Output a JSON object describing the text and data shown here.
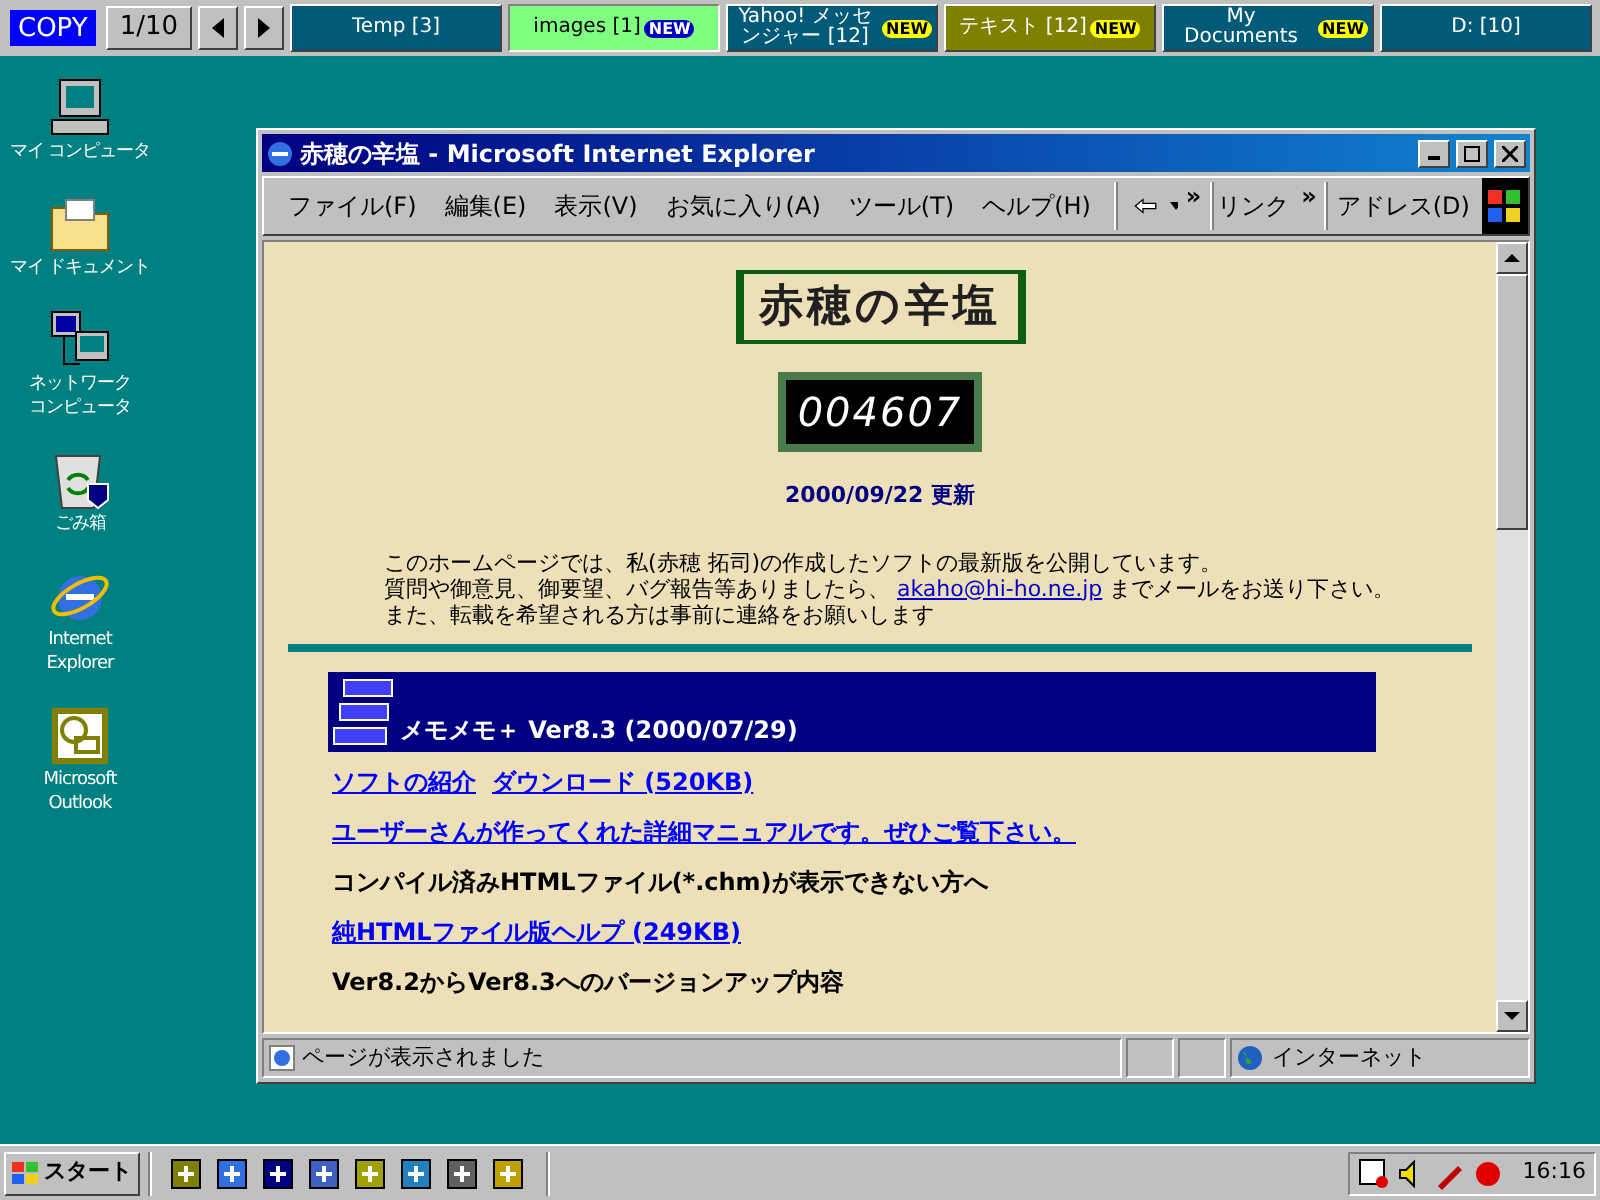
{
  "top_bar": {
    "copy": "COPY",
    "page": "1/10",
    "tasks": [
      {
        "label": "Temp [3]",
        "color": "#005a78",
        "selected": false
      },
      {
        "label": "images [1]",
        "color": "#80ff80",
        "selected": true,
        "badge": "NEW"
      },
      {
        "label": "Yahoo! メッセンジャー [12]",
        "color": "#005a78",
        "selected": false,
        "badge": "NEW"
      },
      {
        "label": "テキスト [12]",
        "color": "#808000",
        "selected": false,
        "badge": "NEW"
      },
      {
        "label": "My Documents",
        "color": "#005a78",
        "selected": false,
        "badge": "NEW"
      },
      {
        "label": "D: [10]",
        "color": "#005a78",
        "selected": false
      }
    ]
  },
  "desktop_icons": [
    {
      "lines": [
        "マイ コンピュータ"
      ],
      "kind": "computer"
    },
    {
      "lines": [
        "マイ ドキュメント"
      ],
      "kind": "folder"
    },
    {
      "lines": [
        "ネットワーク",
        "コンピュータ"
      ],
      "kind": "network"
    },
    {
      "lines": [
        "ごみ箱"
      ],
      "kind": "trash"
    },
    {
      "lines": [
        "Internet",
        "Explorer"
      ],
      "kind": "ie"
    },
    {
      "lines": [
        "Microsoft",
        "Outlook"
      ],
      "kind": "outlook"
    }
  ],
  "window": {
    "title": "赤穂の辛塩 - Microsoft Internet Explorer",
    "menu": [
      "ファイル(F)",
      "編集(E)",
      "表示(V)",
      "お気に入り(A)",
      "ツール(T)",
      "ヘルプ(H)"
    ],
    "toolbar": {
      "more": "»",
      "links": "リンク",
      "links_more": "»",
      "address": "アドレス(D)"
    },
    "page": {
      "logo": "赤穂の辛塩",
      "counter": "004607",
      "updated": "2000/09/22 更新",
      "intro": [
        "このホームページでは、私(赤穂 拓司)の作成したソフトの最新版を公開しています。",
        "質問や御意見、御要望、バグ報告等ありましたら、",
        "までメールをお送り下さい。",
        "また、転載を希望される方は事前に連絡をお願いします"
      ],
      "email": "akaho@hi-ho.ne.jp",
      "banner": "メモメモ＋ Ver8.3 (2000/07/29)",
      "rows": [
        {
          "kind": "links",
          "items": [
            "ソフトの紹介",
            "ダウンロード (520KB)"
          ]
        },
        {
          "kind": "links",
          "items": [
            "ユーザーさんが作ってくれた詳細マニュアルです。ぜひご覧下さい。"
          ]
        },
        {
          "kind": "text",
          "items": [
            "コンパイル済みHTMLファイル(*.chm)が表示できない方へ"
          ]
        },
        {
          "kind": "links",
          "items": [
            "純HTMLファイル版ヘルプ (249KB)"
          ]
        },
        {
          "kind": "text",
          "items": [
            "Ver8.2からVer8.3へのバージョンアップ内容"
          ]
        }
      ]
    },
    "status": {
      "message": "ページが表示されました",
      "zone": "インターネット"
    }
  },
  "taskbar": {
    "start": "スタート",
    "clock": "16:16"
  }
}
